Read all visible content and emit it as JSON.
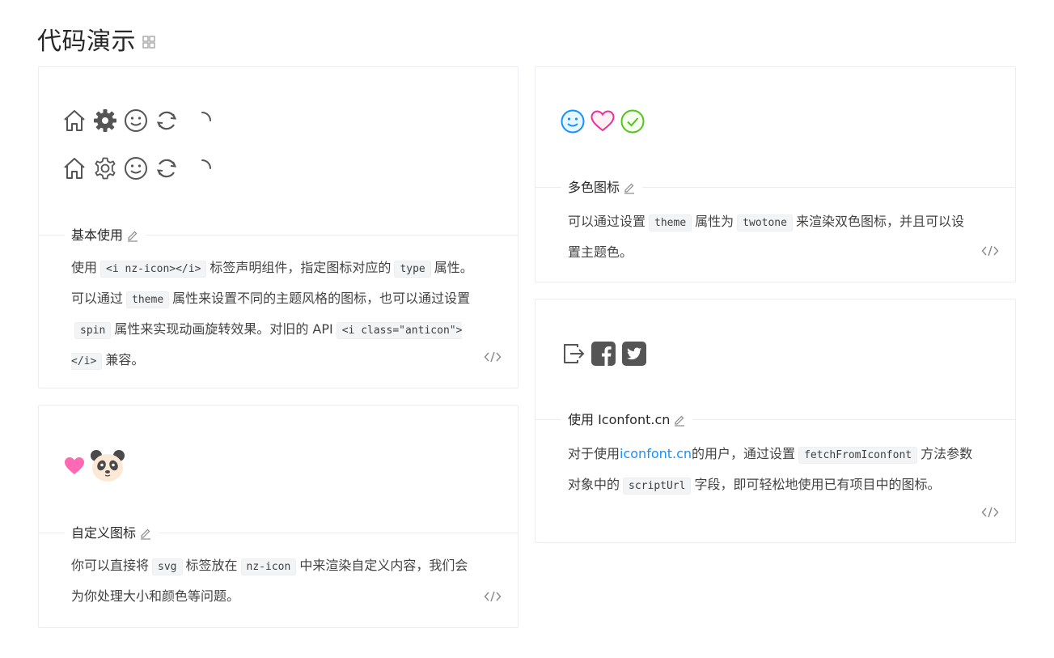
{
  "page": {
    "title": "代码演示"
  },
  "demos": {
    "basic": {
      "title": "基本使用",
      "desc": {
        "p1": "使用",
        "c1": "<i nz-icon></i>",
        "p2": "标签声明组件，指定图标对应的",
        "c2": "type",
        "p3": "属性。可以通过",
        "c3": "theme",
        "p4": "属性来设置不同的主题风格的图标，也可以通过设置",
        "c4": "spin",
        "p5": "属性来实现动画旋转效果。对旧的 API",
        "c5": "<i class=\"anticon\"></i>",
        "p6": "兼容。"
      }
    },
    "twotone": {
      "title": "多色图标",
      "desc": {
        "p1": "可以通过设置",
        "c1": "theme",
        "p2": "属性为",
        "c2": "twotone",
        "p3": "来渲染双色图标，并且可以设置主题色。"
      }
    },
    "custom": {
      "title": "自定义图标",
      "desc": {
        "p1": "你可以直接将",
        "c1": "svg",
        "p2": "标签放在",
        "c2": "nz-icon",
        "p3": "中来渲染自定义内容，我们会为你处理大小和颜色等问题。"
      }
    },
    "iconfont": {
      "title": "使用 Iconfont.cn",
      "desc": {
        "p1": "对于使用",
        "link": "iconfont.cn",
        "p2": "的用户，通过设置",
        "c1": "fetchFromIconfont",
        "p3": "方法参数对象中的",
        "c2": "scriptUrl",
        "p4": "字段，即可轻松地使用已有项目中的图标。"
      }
    }
  },
  "colors": {
    "twotone_blue": "#1890ff",
    "twotone_pink": "#eb2f96",
    "twotone_green": "#52c41a",
    "heart_pink": "#ff69b4",
    "link": "#1890ff"
  }
}
